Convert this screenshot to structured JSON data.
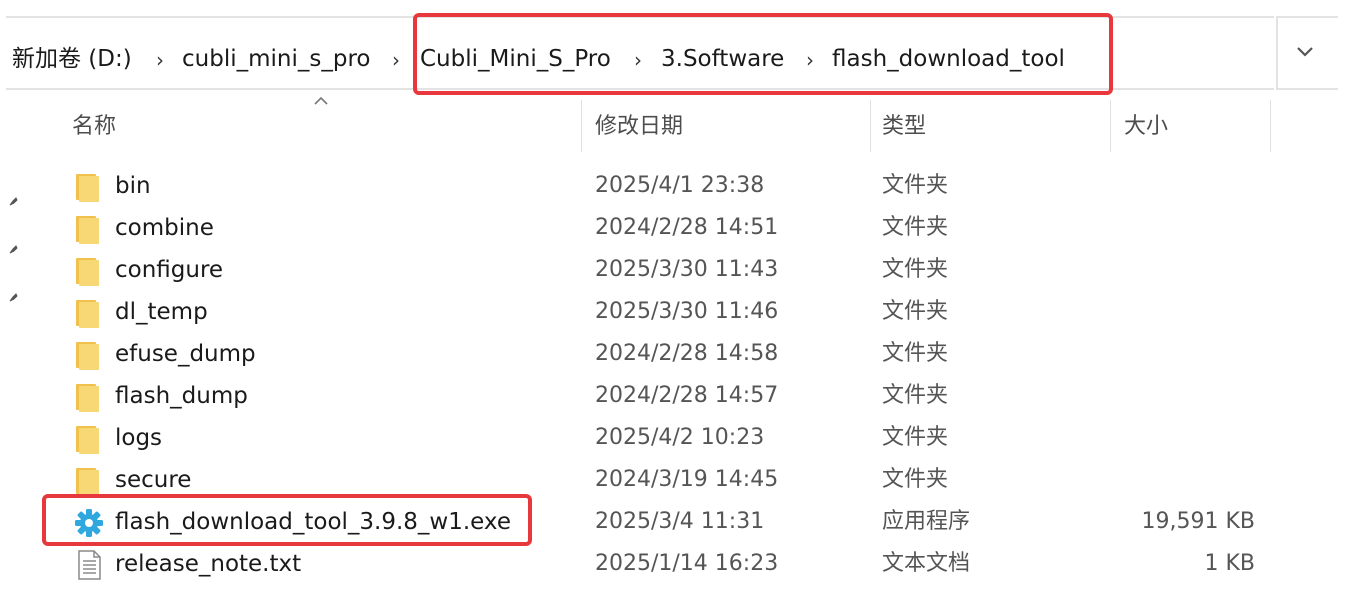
{
  "breadcrumb": {
    "items": [
      {
        "label": "新加卷 (D:)"
      },
      {
        "label": "cubli_mini_s_pro"
      },
      {
        "label": "Cubli_Mini_S_Pro"
      },
      {
        "label": "3.Software"
      },
      {
        "label": "flash_download_tool"
      }
    ],
    "separator": "›",
    "dropdown_icon": "chevron-down-icon"
  },
  "columns": {
    "name": "名称",
    "date": "修改日期",
    "type": "类型",
    "size": "大小",
    "sort_indicator": "caret-up-icon"
  },
  "files": [
    {
      "name": "bin",
      "date": "2025/4/1 23:38",
      "type": "文件夹",
      "size": "",
      "icon": "folder-icon"
    },
    {
      "name": "combine",
      "date": "2024/2/28 14:51",
      "type": "文件夹",
      "size": "",
      "icon": "folder-icon"
    },
    {
      "name": "configure",
      "date": "2025/3/30 11:43",
      "type": "文件夹",
      "size": "",
      "icon": "folder-icon"
    },
    {
      "name": "dl_temp",
      "date": "2025/3/30 11:46",
      "type": "文件夹",
      "size": "",
      "icon": "folder-icon"
    },
    {
      "name": "efuse_dump",
      "date": "2024/2/28 14:58",
      "type": "文件夹",
      "size": "",
      "icon": "folder-icon"
    },
    {
      "name": "flash_dump",
      "date": "2024/2/28 14:57",
      "type": "文件夹",
      "size": "",
      "icon": "folder-icon"
    },
    {
      "name": "logs",
      "date": "2025/4/2 10:23",
      "type": "文件夹",
      "size": "",
      "icon": "folder-icon"
    },
    {
      "name": "secure",
      "date": "2024/3/19 14:45",
      "type": "文件夹",
      "size": "",
      "icon": "folder-icon"
    },
    {
      "name": "flash_download_tool_3.9.8_w1.exe",
      "date": "2025/3/4 11:31",
      "type": "应用程序",
      "size": "19,591 KB",
      "icon": "gear-app-icon"
    },
    {
      "name": "release_note.txt",
      "date": "2025/1/14 16:23",
      "type": "文本文档",
      "size": "1 KB",
      "icon": "text-file-icon"
    }
  ],
  "colors": {
    "highlight": "#e8383d",
    "folder": "#f8d775",
    "app_icon": "#2fa8e0"
  }
}
